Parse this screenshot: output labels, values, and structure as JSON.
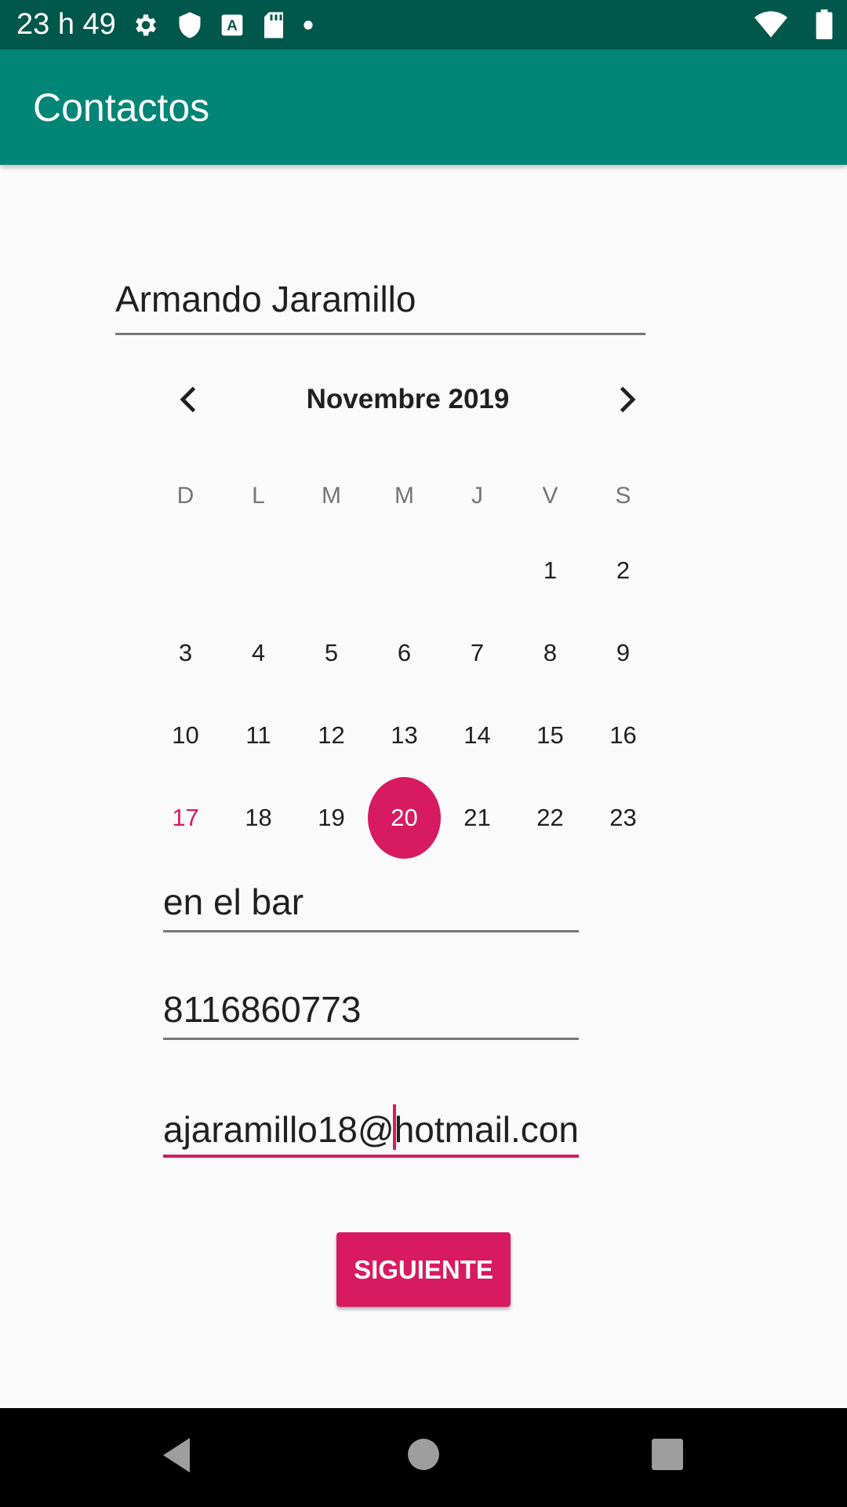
{
  "status_bar": {
    "time": "23 h 49",
    "icons_left": [
      "settings-icon",
      "shield-icon",
      "font-a-icon",
      "sd-card-icon",
      "dot-icon"
    ],
    "icons_right": [
      "wifi-icon",
      "battery-icon"
    ]
  },
  "app_bar": {
    "title": "Contactos",
    "color": "#008577"
  },
  "form": {
    "name_value": "Armando Jaramillo",
    "description_value": "en el bar",
    "phone_value": "8116860773",
    "email_before_cursor": "ajaramillo18@",
    "email_after_cursor": "hotmail.con",
    "submit_label": "SIGUIENTE"
  },
  "calendar": {
    "month_label": "Novembre 2019",
    "weekdays": [
      "D",
      "L",
      "M",
      "M",
      "J",
      "V",
      "S"
    ],
    "rows": [
      [
        "",
        "",
        "",
        "",
        "",
        "1",
        "2"
      ],
      [
        "3",
        "4",
        "5",
        "6",
        "7",
        "8",
        "9"
      ],
      [
        "10",
        "11",
        "12",
        "13",
        "14",
        "15",
        "16"
      ],
      [
        "17",
        "18",
        "19",
        "20",
        "21",
        "22",
        "23"
      ]
    ],
    "today": "17",
    "selected": "20",
    "accent_color": "#d81b60"
  }
}
